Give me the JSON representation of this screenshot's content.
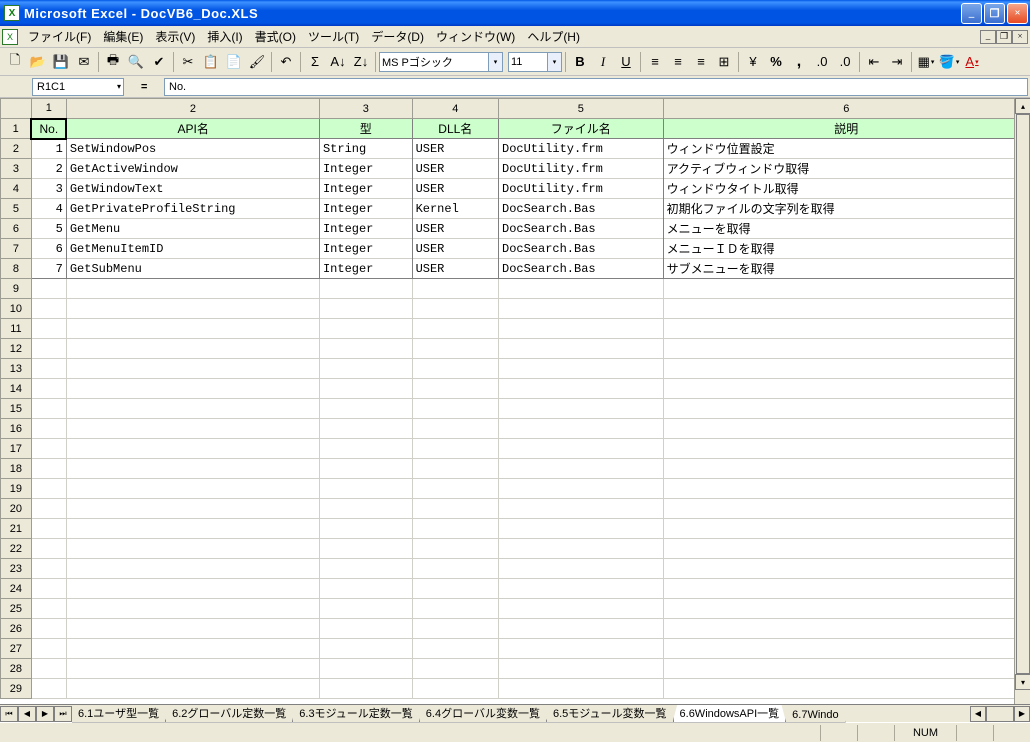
{
  "window": {
    "title": "Microsoft Excel - DocVB6_Doc.XLS"
  },
  "menu": {
    "items": [
      "ファイル(F)",
      "編集(E)",
      "表示(V)",
      "挿入(I)",
      "書式(O)",
      "ツール(T)",
      "データ(D)",
      "ウィンドウ(W)",
      "ヘルプ(H)"
    ]
  },
  "toolbar": {
    "font_name": "MS Pゴシック",
    "font_size": "11",
    "bold": "B",
    "italic": "I",
    "underline": "U",
    "percent": "%",
    "comma": ","
  },
  "formula_bar": {
    "name_box": "R1C1",
    "fx": "=",
    "content": "No."
  },
  "col_headers": [
    "",
    "1",
    "2",
    "3",
    "4",
    "5",
    "6"
  ],
  "header_row": {
    "no": "No.",
    "api": "API名",
    "type": "型",
    "dll": "DLL名",
    "file": "ファイル名",
    "desc": "説明"
  },
  "rows": [
    {
      "n": "1",
      "api": "SetWindowPos",
      "type": "String",
      "dll": "USER",
      "file": "DocUtility.frm",
      "desc": "ウィンドウ位置設定"
    },
    {
      "n": "2",
      "api": "GetActiveWindow",
      "type": "Integer",
      "dll": "USER",
      "file": "DocUtility.frm",
      "desc": "アクティブウィンドウ取得"
    },
    {
      "n": "3",
      "api": "GetWindowText",
      "type": "Integer",
      "dll": "USER",
      "file": "DocUtility.frm",
      "desc": "ウィンドウタイトル取得"
    },
    {
      "n": "4",
      "api": "GetPrivateProfileString",
      "type": "Integer",
      "dll": "Kernel",
      "file": "DocSearch.Bas",
      "desc": "初期化ファイルの文字列を取得"
    },
    {
      "n": "5",
      "api": "GetMenu",
      "type": "Integer",
      "dll": "USER",
      "file": "DocSearch.Bas",
      "desc": "メニューを取得"
    },
    {
      "n": "6",
      "api": "GetMenuItemID",
      "type": "Integer",
      "dll": "USER",
      "file": "DocSearch.Bas",
      "desc": "メニューＩＤを取得"
    },
    {
      "n": "7",
      "api": "GetSubMenu",
      "type": "Integer",
      "dll": "USER",
      "file": "DocSearch.Bas",
      "desc": "サブメニューを取得"
    }
  ],
  "empty_row_labels": [
    "9",
    "10",
    "11",
    "12",
    "13",
    "14",
    "15",
    "16",
    "17",
    "18",
    "19",
    "20",
    "21",
    "22",
    "23",
    "24",
    "25",
    "26",
    "27",
    "28",
    "29"
  ],
  "sheet_tabs": [
    {
      "label": "6.1ユーザ型一覧",
      "active": false
    },
    {
      "label": "6.2グローバル定数一覧",
      "active": false
    },
    {
      "label": "6.3モジュール定数一覧",
      "active": false
    },
    {
      "label": "6.4グローバル変数一覧",
      "active": false
    },
    {
      "label": "6.5モジュール変数一覧",
      "active": false
    },
    {
      "label": "6.6WindowsAPI一覧",
      "active": true
    },
    {
      "label": "6.7Windo",
      "active": false
    }
  ],
  "statusbar": {
    "num": "NUM"
  }
}
